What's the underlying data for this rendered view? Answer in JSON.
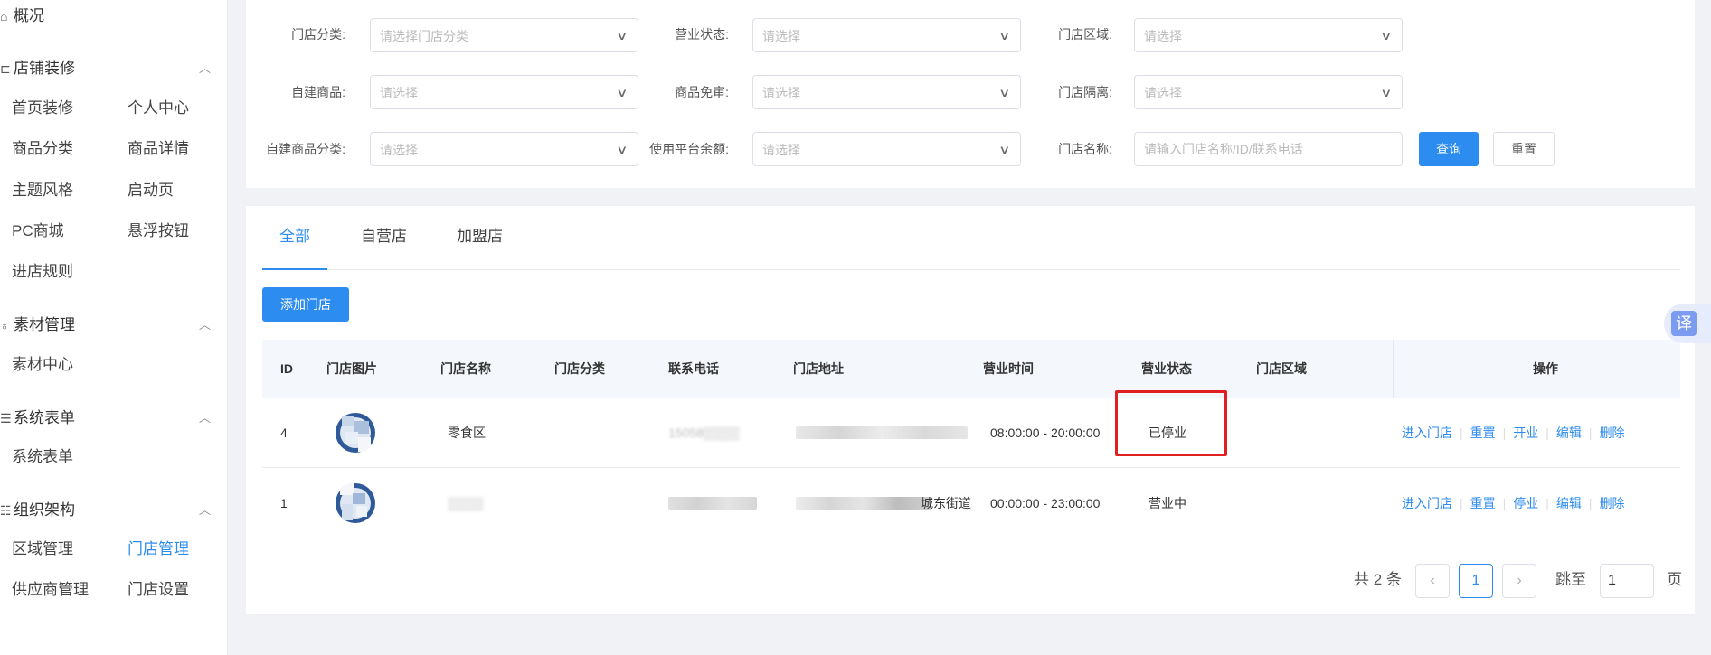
{
  "sidebar": {
    "groups": [
      {
        "id": "overview",
        "label": "概况",
        "icon": "home-icon",
        "collapsible": false
      },
      {
        "id": "decor",
        "label": "店铺装修",
        "icon": "layout-icon",
        "collapsible": true
      },
      {
        "id": "material",
        "label": "素材管理",
        "icon": "bulb-icon",
        "collapsible": true
      },
      {
        "id": "forms",
        "label": "系统表单",
        "icon": "list-icon",
        "collapsible": true
      },
      {
        "id": "org",
        "label": "组织架构",
        "icon": "org-icon",
        "collapsible": true
      }
    ],
    "items": {
      "home_decor": "首页装修",
      "personal_center": "个人中心",
      "category": "商品分类",
      "product_detail": "商品详情",
      "theme": "主题风格",
      "splash": "启动页",
      "pc_mall": "PC商城",
      "float_button": "悬浮按钮",
      "store_rules": "进店规则",
      "material_center": "素材中心",
      "system_form": "系统表单",
      "region_mgmt": "区域管理",
      "store_mgmt": "门店管理",
      "supplier_mgmt": "供应商管理",
      "store_settings": "门店设置"
    },
    "active_item": "store_mgmt"
  },
  "filters": {
    "store_category": {
      "label": "门店分类:",
      "placeholder": "请选择门店分类"
    },
    "business_status": {
      "label": "营业状态:",
      "placeholder": "请选择"
    },
    "store_region": {
      "label": "门店区域:",
      "placeholder": "请选择"
    },
    "self_product": {
      "label": "自建商品:",
      "placeholder": "请选择"
    },
    "product_exempt": {
      "label": "商品免审:",
      "placeholder": "请选择"
    },
    "store_isolation": {
      "label": "门店隔离:",
      "placeholder": "请选择"
    },
    "self_product_category": {
      "label": "自建商品分类:",
      "placeholder": "请选择"
    },
    "platform_balance": {
      "label": "使用平台余额:",
      "placeholder": "请选择"
    },
    "store_name": {
      "label": "门店名称:",
      "placeholder": "请输入门店名称/ID/联系电话"
    },
    "search_label": "查询",
    "reset_label": "重置"
  },
  "tabs": [
    {
      "label": "全部",
      "active": true
    },
    {
      "label": "自营店",
      "active": false
    },
    {
      "label": "加盟店",
      "active": false
    }
  ],
  "add_store_label": "添加门店",
  "table": {
    "columns": [
      "ID",
      "门店图片",
      "门店名称",
      "门店分类",
      "联系电话",
      "门店地址",
      "营业时间",
      "营业状态",
      "门店区域",
      "操作"
    ],
    "rows": [
      {
        "id": "4",
        "name": "零食区",
        "category": "",
        "phone": "15058▒▒▒▒",
        "address_tail": "",
        "hours": "08:00:00 - 20:00:00",
        "status": "已停业",
        "region": "",
        "actions": [
          "进入门店",
          "重置",
          "开业",
          "编辑",
          "删除"
        ]
      },
      {
        "id": "1",
        "name": "▒▒▒▒",
        "category": "",
        "phone": "",
        "address_tail": "城东街道",
        "hours": "00:00:00 - 23:00:00",
        "status": "营业中",
        "region": "",
        "actions": [
          "进入门店",
          "重置",
          "停业",
          "编辑",
          "删除"
        ]
      }
    ]
  },
  "pagination": {
    "total_text": "共 2 条",
    "current_page": "1",
    "jump_prefix": "跳至",
    "jump_value": "1",
    "jump_suffix": "页"
  },
  "translate_label": "译",
  "colors": {
    "accent": "#2d8cf0",
    "highlight": "#e02020"
  }
}
